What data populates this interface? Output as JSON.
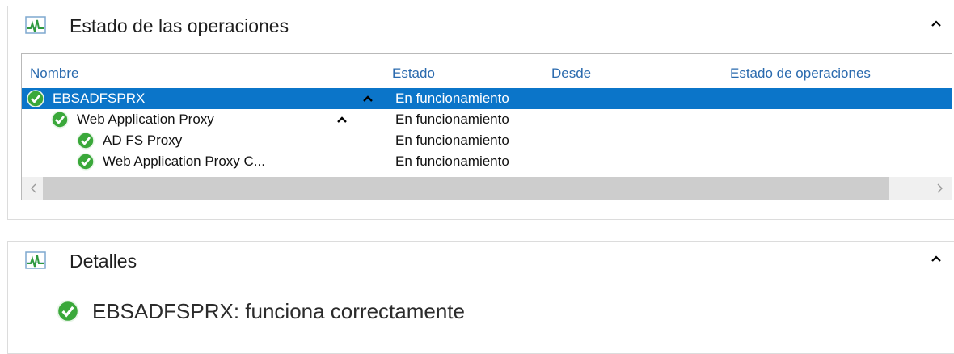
{
  "operations_panel": {
    "title": "Estado de las operaciones",
    "icon": "health-chart-icon"
  },
  "grid": {
    "columns": [
      "Nombre",
      "Estado",
      "Desde",
      "Estado de operaciones"
    ],
    "rows": [
      {
        "name": "EBSADFSPRX",
        "state": "En funcionamiento",
        "since": "",
        "ops_state": "",
        "level": 0,
        "selected": true,
        "expanded": true
      },
      {
        "name": "Web Application Proxy",
        "state": "En funcionamiento",
        "since": "",
        "ops_state": "",
        "level": 1,
        "selected": false,
        "expanded": true
      },
      {
        "name": "AD FS Proxy",
        "state": "En funcionamiento",
        "since": "",
        "ops_state": "",
        "level": 2,
        "selected": false
      },
      {
        "name": "Web Application Proxy C...",
        "state": "En funcionamiento",
        "since": "",
        "ops_state": "",
        "level": 2,
        "selected": false
      }
    ]
  },
  "details_panel": {
    "title": "Detalles",
    "message": "EBSADFSPRX: funciona correctamente"
  },
  "colors": {
    "selection": "#0b75c9",
    "header_text": "#2a6aae",
    "ok_green": "#3aa83a"
  }
}
